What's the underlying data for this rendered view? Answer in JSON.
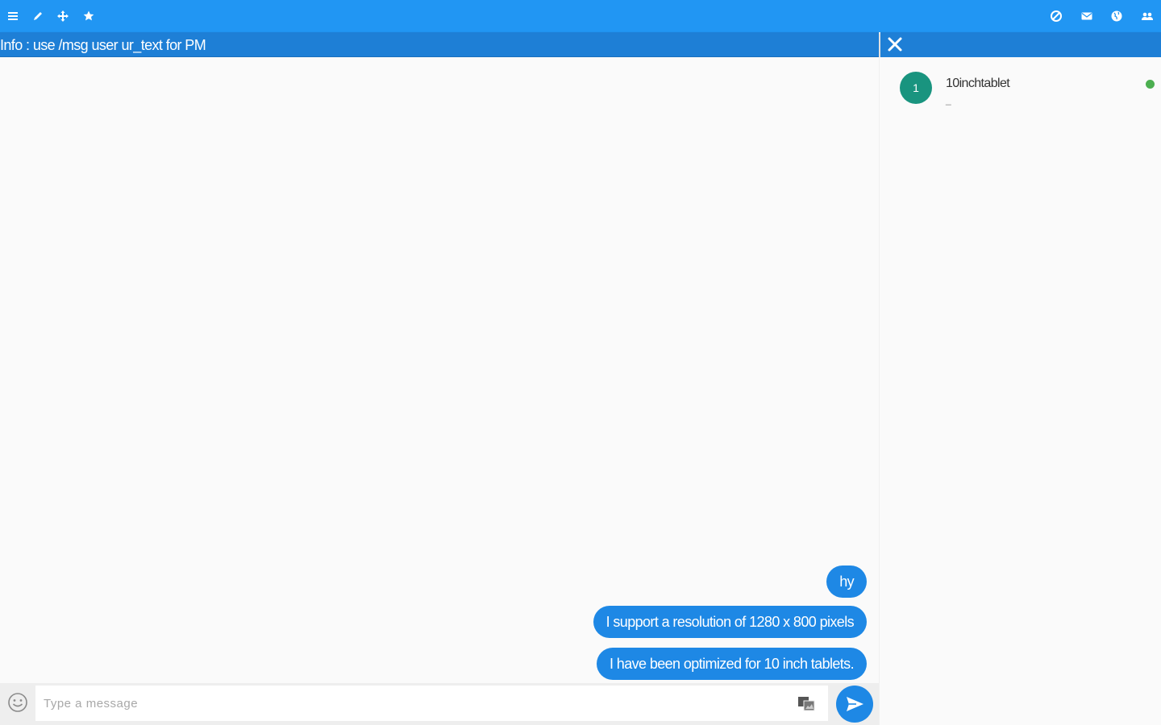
{
  "colors": {
    "topbar": "#2196f3",
    "infobar": "#1e7fd6",
    "bubble": "#1e88e5",
    "avatar": "#19947f",
    "online": "#4caf50"
  },
  "topbar": {
    "left_icons": [
      "menu-icon",
      "pencil-icon",
      "move-icon",
      "star-icon"
    ],
    "right_icons": [
      "block-icon",
      "mail-icon",
      "globe-icon",
      "users-icon"
    ]
  },
  "info": {
    "text": "Info : use /msg user ur_text for PM"
  },
  "messages": [
    {
      "text": "hy"
    },
    {
      "text": "I support a resolution of 1280 x 800 pixels"
    },
    {
      "text": "I have been optimized for 10 inch tablets."
    }
  ],
  "users": [
    {
      "name": "10inchtablet",
      "avatar_letter": "1",
      "sub": "_",
      "status": "online"
    }
  ],
  "composer": {
    "placeholder": "Type a message"
  }
}
